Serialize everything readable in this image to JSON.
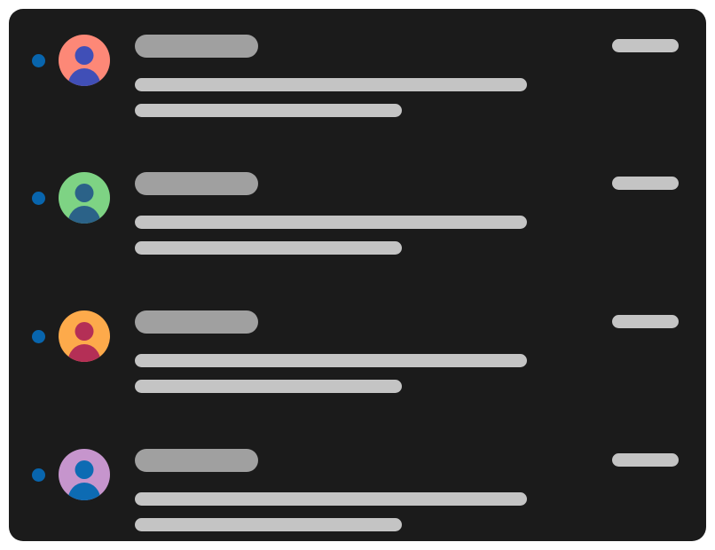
{
  "list": {
    "items": [
      {
        "status": "unread",
        "avatar": {
          "icon": "person-icon",
          "background": "#FD8877",
          "figure": "#404FB7"
        }
      },
      {
        "status": "unread",
        "avatar": {
          "icon": "person-icon",
          "background": "#7ED384",
          "figure": "#2B6288"
        }
      },
      {
        "status": "unread",
        "avatar": {
          "icon": "person-icon",
          "background": "#FDAA4B",
          "figure": "#B42F56"
        }
      },
      {
        "status": "unread",
        "avatar": {
          "icon": "person-icon",
          "background": "#C695CD",
          "figure": "#0D6BB3"
        }
      }
    ]
  },
  "colors": {
    "card_background": "#1B1B1B",
    "page_background": "#FFFFFF",
    "unread_indicator": "#0865AD",
    "title_placeholder": "#A0A0A0",
    "text_placeholder": "#C4C4C4"
  }
}
